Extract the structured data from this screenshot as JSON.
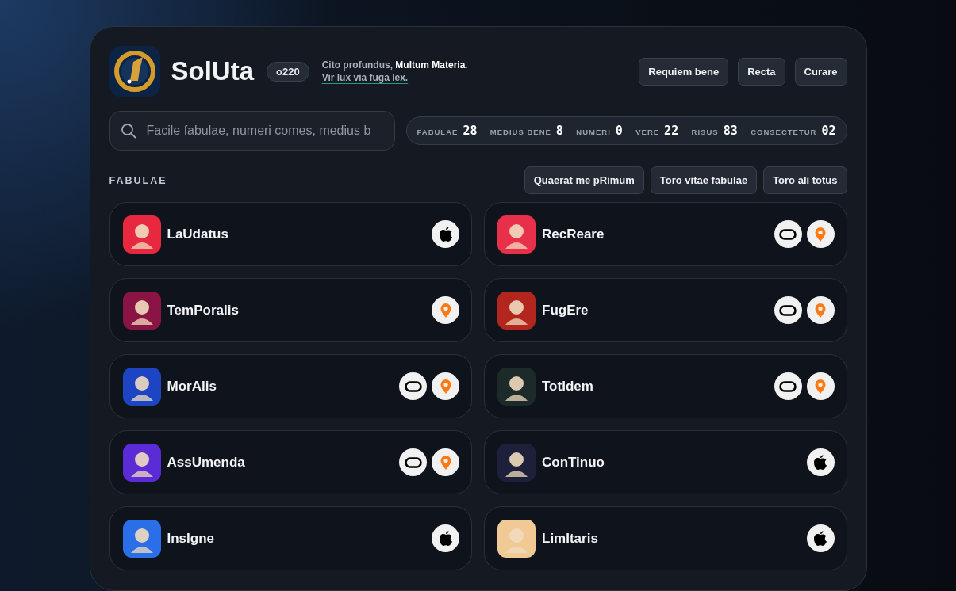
{
  "header": {
    "title": "SolUta",
    "version": "o220",
    "tagline": [
      "Cito profundus, **Multum Materia**.",
      "Vir lux via fuga lex."
    ],
    "buttons": [
      "Requiem bene",
      "Recta",
      "Curare"
    ]
  },
  "search": {
    "placeholder": "Facile fabulae, numeri comes, medius b"
  },
  "stats": [
    {
      "label": "FABULAE",
      "value": "28"
    },
    {
      "label": "MEDIUS BENE",
      "value": "8"
    },
    {
      "label": "NUMERI",
      "value": "0"
    },
    {
      "label": "VERE",
      "value": "22"
    },
    {
      "label": "RISUS",
      "value": "83"
    },
    {
      "label": "CONSECTETUR",
      "value": "02"
    }
  ],
  "section": {
    "title": "FABULAE",
    "buttons": [
      "Quaerat me pRimum",
      "Toro vitae fabulae",
      "Toro ali totus"
    ]
  },
  "apps": [
    {
      "name": "LaUdatus",
      "color": "#e8283e",
      "platforms": [
        {
          "kind": "apple"
        }
      ]
    },
    {
      "name": "RecReare",
      "color": "#e9304a",
      "platforms": [
        {
          "kind": "headset"
        },
        {
          "kind": "pin"
        }
      ]
    },
    {
      "name": "TemPoralis",
      "color": "#8a1544",
      "platforms": [
        {
          "kind": "pin"
        }
      ]
    },
    {
      "name": "FugEre",
      "color": "#b3261e",
      "platforms": [
        {
          "kind": "headset"
        },
        {
          "kind": "pin"
        }
      ]
    },
    {
      "name": "MorAlis",
      "color": "#1d44c2",
      "platforms": [
        {
          "kind": "headset"
        },
        {
          "kind": "pin"
        }
      ]
    },
    {
      "name": "TotIdem",
      "color": "#1c2a2a",
      "platforms": [
        {
          "kind": "headset"
        },
        {
          "kind": "pin"
        }
      ]
    },
    {
      "name": "AssUmenda",
      "color": "#5b2bd6",
      "platforms": [
        {
          "kind": "headset"
        },
        {
          "kind": "pin"
        }
      ]
    },
    {
      "name": "ConTinuo",
      "color": "#1e1f3a",
      "platforms": [
        {
          "kind": "apple"
        }
      ]
    },
    {
      "name": "InsIgne",
      "color": "#2a6fe8",
      "platforms": [
        {
          "kind": "apple"
        }
      ]
    },
    {
      "name": "LimItaris",
      "color": "#f0c995",
      "platforms": [
        {
          "kind": "apple"
        }
      ]
    }
  ]
}
